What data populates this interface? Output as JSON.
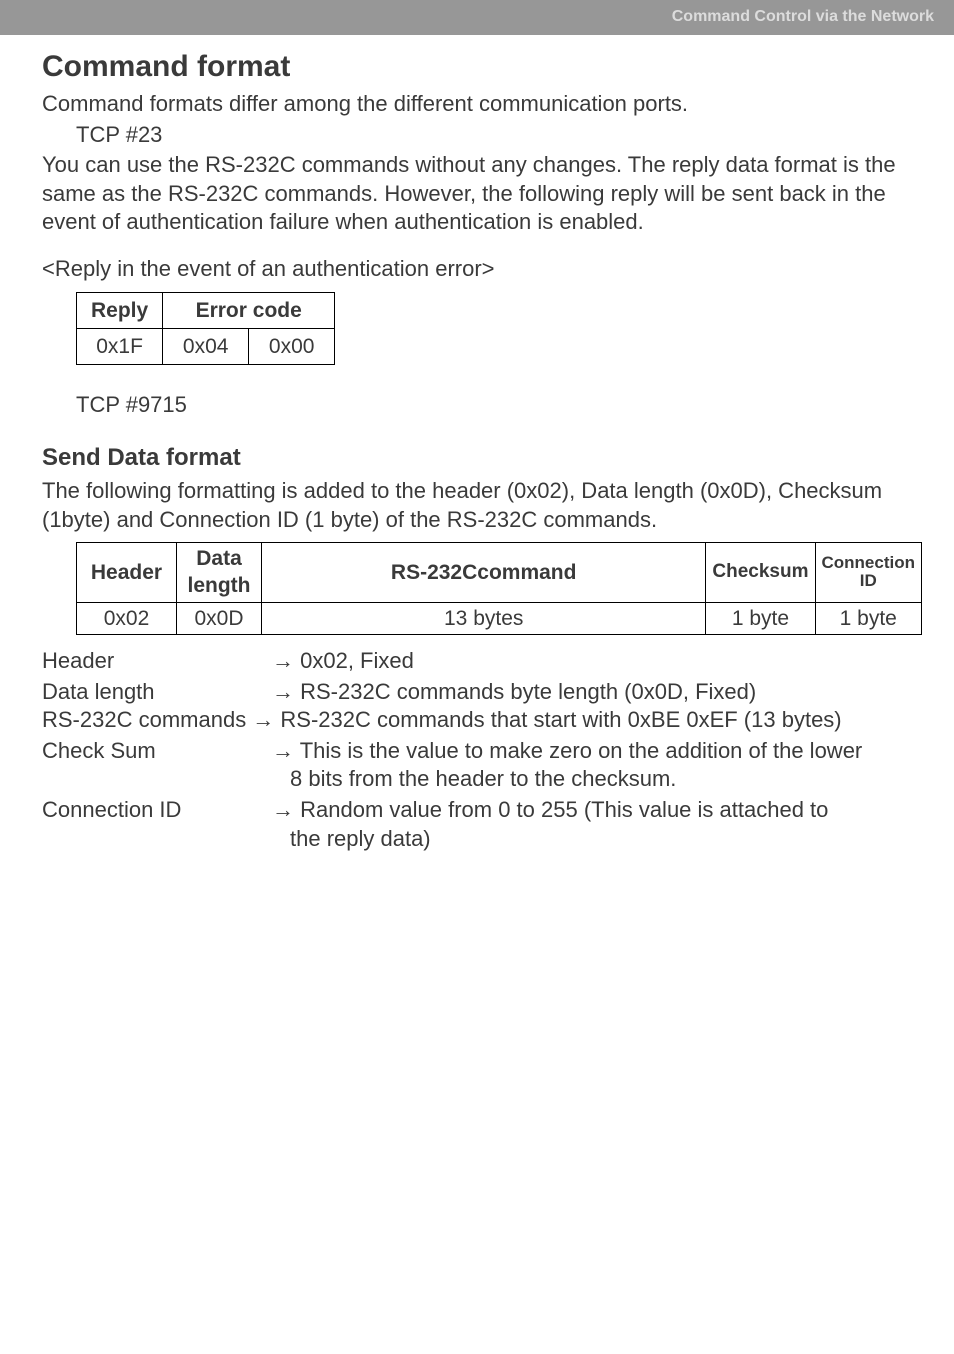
{
  "topbar": "Command Control via the Network",
  "h1": "Command format",
  "p1": "Command formats differ among the different communication ports.",
  "tcp23": "TCP #23",
  "p2": "You can use the RS-232C commands without any changes. The reply data format is the same as the RS-232C commands. However, the following reply will be sent back in the event of authentication failure when authentication is enabled.",
  "reply_caption": "<Reply in the event of an authentication error>",
  "t1": {
    "h_reply": "Reply",
    "h_err": "Error code",
    "r_reply": "0x1F",
    "r_e1": "0x04",
    "r_e2": "0x00"
  },
  "tcp9715": "TCP #9715",
  "h2": "Send Data format",
  "p3": "The following formatting is added to the header (0x02), Data length (0x0D), Checksum (1byte) and Connection ID (1 byte) of the RS-232C commands.",
  "t2": {
    "h_header": "Header",
    "h_dl": "Data length",
    "h_cmd": "RS-232Ccommand",
    "h_ck": "Checksum",
    "h_ci": "Connection ID",
    "r_header": "0x02",
    "r_dl": "0x0D",
    "r_cmd": "13 bytes",
    "r_ck": "1 byte",
    "r_ci": "1 byte"
  },
  "defs": {
    "l1": "Header",
    "v1": "→ 0x02, Fixed",
    "l2": "Data length",
    "v2": "→ RS-232C commands byte length (0x0D, Fixed)",
    "l3": "RS-232C commands → RS-232C commands that start with 0xBE 0xEF (13 bytes)",
    "l4": "Check Sum",
    "v4a": "→ This is the value to make zero on the addition of the lower",
    "v4b": "8 bits from the header to the checksum.",
    "l5": "Connection ID",
    "v5a": "→ Random value from 0 to 255 (This value is attached to",
    "v5b": "the reply data)"
  }
}
